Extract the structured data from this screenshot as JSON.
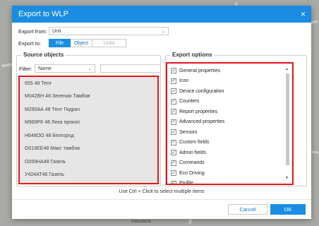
{
  "background": {
    "map_label": "Ракшинов"
  },
  "dialog": {
    "title": "Export to WLP",
    "close_glyph": "×",
    "export_from": {
      "label": "Export from:",
      "value": "Unit"
    },
    "export_to": {
      "label": "Export to:",
      "options": [
        "File",
        "Object",
        "Units"
      ],
      "selected": "File"
    },
    "source": {
      "title": "Source objects",
      "filter_label": "Filter:",
      "filter_select": "Name",
      "filter_value": "",
      "items": [
        "655 48 Тент",
        "М042ВН 48 Зеленая Тамбов",
        "М290АА 48 Тент Гидрач",
        "М969РК 48 Лека прокоп",
        "Н648ОО 48 Белгород",
        "О019ЕЕ48 Макс тамбов",
        "О059НА48 Газель",
        "У424АТ48 Газель"
      ]
    },
    "options": {
      "title": "Export options",
      "items": [
        "General properties",
        "Icon",
        "Device configuration",
        "Counters",
        "Report properties",
        "Advanced properties",
        "Sensors",
        "Custom fields",
        "Admin fields",
        "Commands",
        "Eco Driving",
        "Profile"
      ],
      "check_glyph": "✓"
    },
    "hint": "Use Ctrl + Click to select multiple items",
    "cancel_label": "Cancel",
    "ok_label": "OK"
  },
  "colors": {
    "accent": "#1a8de2",
    "highlight_border": "#e21818"
  }
}
